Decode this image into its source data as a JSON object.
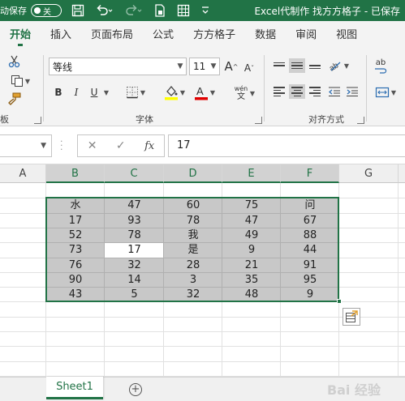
{
  "titlebar": {
    "autosave_label": "动保存",
    "toggle_label": "关",
    "title": "Excel代制作 找方方格子 - 已保存"
  },
  "tabs": [
    "开始",
    "插入",
    "页面布局",
    "公式",
    "方方格子",
    "数据",
    "审阅",
    "视图"
  ],
  "ribbon": {
    "clipboard_label": "板",
    "font_group_label": "字体",
    "align_group_label": "对齐方式",
    "font_name": "等线",
    "font_size": "11",
    "bold": "B",
    "italic": "I",
    "underline": "U",
    "grow_font": "A",
    "shrink_font": "A",
    "wen_top": "wén",
    "wen_bottom": "文",
    "ab_label": "ab",
    "colors": {
      "fill": "#ffff00",
      "font": "#e00000",
      "accent": "#217346"
    }
  },
  "formula_bar": {
    "name_box": "",
    "cancel": "✕",
    "enter": "✓",
    "fx": "fx",
    "value": "17"
  },
  "columns": [
    "A",
    "B",
    "C",
    "D",
    "E",
    "F",
    "G"
  ],
  "table": [
    [
      "水",
      "47",
      "60",
      "75",
      "问"
    ],
    [
      "17",
      "93",
      "78",
      "47",
      "67"
    ],
    [
      "52",
      "78",
      "我",
      "49",
      "88"
    ],
    [
      "73",
      "17",
      "是",
      "9",
      "44"
    ],
    [
      "76",
      "32",
      "28",
      "21",
      "91"
    ],
    [
      "90",
      "14",
      "3",
      "35",
      "95"
    ],
    [
      "43",
      "5",
      "32",
      "48",
      "9"
    ]
  ],
  "sheets": [
    "Sheet1"
  ],
  "add_sheet": "+",
  "watermark": "Bai 经验"
}
